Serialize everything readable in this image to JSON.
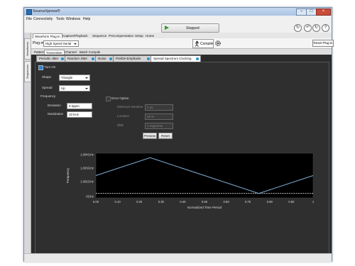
{
  "window": {
    "title": "SourceXpress®"
  },
  "menu": [
    "File",
    "Connectivity",
    "Tools",
    "Windows",
    "Help"
  ],
  "toolbar": {
    "stopped_label": "Stopped"
  },
  "side_tabs": [
    "Waveforms",
    "Sequences"
  ],
  "ribbon_tabs": [
    "Waveform Plug-in",
    "Capture/Playback",
    "Sequence",
    "Precompensation",
    "Setup",
    "Home"
  ],
  "ribbon": {
    "plugin_label": "Plug-in",
    "plugin_value": "High Speed Serial",
    "compile_label": "Compile",
    "reset_label": "Reset Plug-in"
  },
  "sub_tabs": [
    "Pattern",
    "Transmitter",
    "Channel",
    "Batch Compile"
  ],
  "content_tabs": [
    "Periodic Jitter",
    "Random Jitter",
    "Noise",
    "Pre/De-Emphasis",
    "Spread Spectrum Clocking"
  ],
  "ssc": {
    "turn_on": "Turn On",
    "shape_label": "Shape",
    "shape_value": "Triangle",
    "spread_label": "Spread",
    "spread_value": "Up",
    "frequency_label": "Frequency",
    "deviation_label": "Deviation",
    "deviation_value": "5 kppm",
    "modulation_label": "Modulation",
    "modulation_value": "10 kHz",
    "error_option_label": "Error Option",
    "min_duration_label": "Minimum Duration",
    "min_duration_value": "1 us",
    "location_label": "Location",
    "location_value": "20 %",
    "dfdt_label": "df/dt",
    "dfdt_value": "1 mppm/us",
    "preview_label": "Preview",
    "reset_label": "Reset"
  },
  "chart_data": {
    "type": "line",
    "xlabel": "Normalized Time Period",
    "ylabel": "Frequency",
    "xlim": [
      0,
      1
    ],
    "x_ticks": [
      "0.00",
      "0.10",
      "0.20",
      "0.30",
      "0.40",
      "0.50",
      "0.60",
      "0.70",
      "0.80",
      "0.90",
      "1"
    ],
    "y_ticks": [
      "1.004GHz",
      "1.003GHz",
      "1.002GHz",
      "0GHz"
    ],
    "series": [
      {
        "x": [
          0,
          0.25,
          0.75,
          1
        ],
        "y": [
          1.0016,
          1.0032,
          1.0,
          1.0016
        ],
        "color": "#7fb0d8"
      }
    ],
    "reference_line": {
      "y": 1.0,
      "style": "dashed",
      "color": "#e0e0e0"
    }
  }
}
